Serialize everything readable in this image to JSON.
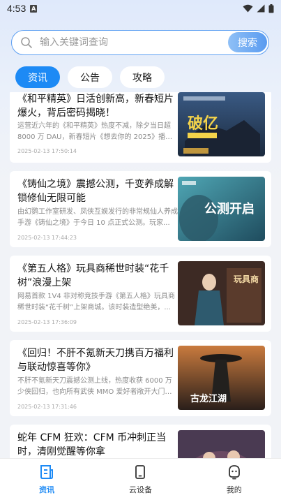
{
  "status_bar": {
    "time": "4:53"
  },
  "search": {
    "placeholder": "输入关键词查询",
    "button_label": "搜索"
  },
  "tabs": [
    {
      "label": "资讯",
      "active": true
    },
    {
      "label": "公告",
      "active": false
    },
    {
      "label": "攻略",
      "active": false
    }
  ],
  "articles": [
    {
      "title": "《和平精英》日活创新高，新春短片爆火，背后密码揭晓！",
      "summary": "运营近六年的《和平精英》热度不减，除夕当日超 8000 万 DAU，新春短片《想去你的 2025》播放量...",
      "time": "2025-02-13 17:50:14",
      "thumb_text": "破亿"
    },
    {
      "title": "《铸仙之境》震撼公测，千变养成解锁修仙无限可能",
      "summary": "由幻鹦工作室研发、凤侠互娱发行的非常规仙人养成手游《铸仙之境》于今日 10 点正式公测。玩家...",
      "time": "2025-02-13 17:44:23",
      "thumb_text": "公测开启"
    },
    {
      "title": "《第五人格》玩具商稀世时装“花千树”浪漫上架",
      "summary": "网易首款 1V4 非对称竞技手游《第五人格》玩具商稀世时装“花千树”上架商城。该时装造型绝美，...",
      "time": "2025-02-13 17:36:09",
      "thumb_text": "玩具商"
    },
    {
      "title": "《回归！不肝不氪新天刀携百万福利与联动惊喜等你》",
      "summary": "不肝不氪新天刀震撼公测上线，热度收获 6000 万少侠回归，也向所有武侠 MMO 爱好者敞开大门。游...",
      "time": "2025-02-13 17:31:46",
      "thumb_text": "古龙江湖"
    },
    {
      "title": "蛇年 CFM 狂欢：CFM 币冲刺正当时，清刚觉醒等你拿",
      "summary": "",
      "time": "",
      "thumb_text": ""
    }
  ],
  "bottom_nav": [
    {
      "label": "资讯",
      "icon": "news-icon",
      "active": true
    },
    {
      "label": "云设备",
      "icon": "phone-icon",
      "active": false
    },
    {
      "label": "我的",
      "icon": "profile-icon",
      "active": false
    }
  ],
  "colors": {
    "accent": "#1d8af5",
    "search_border": "#5c9ff2",
    "background": "#f1f3f7"
  }
}
